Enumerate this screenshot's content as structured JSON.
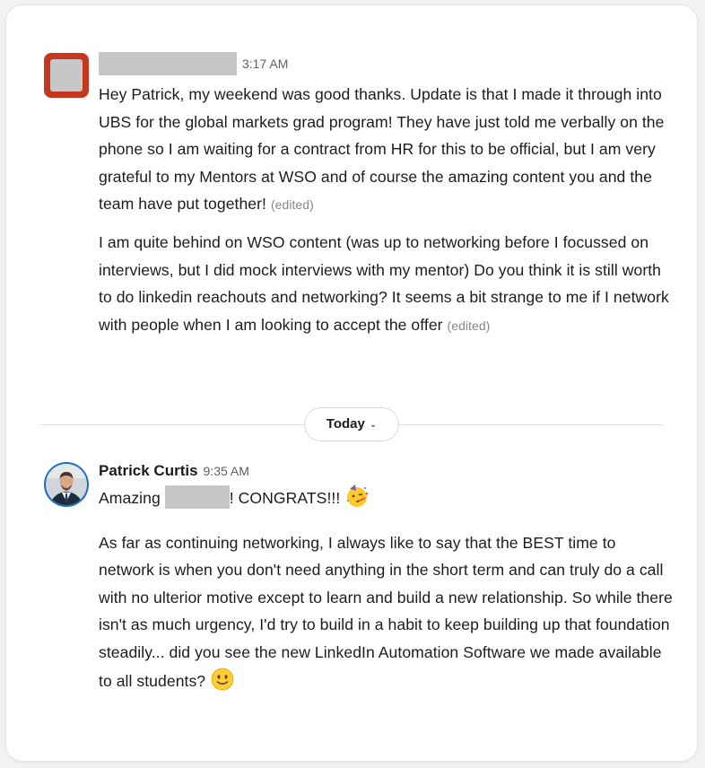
{
  "messages": [
    {
      "sender": "",
      "time": "3:17 AM",
      "paragraphs": [
        {
          "text": "Hey Patrick, my weekend was good thanks. Update is that I made it through into UBS for the global markets grad program! They have just told me verbally on the phone so I am waiting for a contract from HR for this to be official, but I am very grateful to my Mentors at WSO and of course the amazing content you and the team have put together!",
          "edited": "(edited)"
        },
        {
          "text": "I am quite behind on WSO content (was up to networking before I focussed on interviews, but I did mock interviews with my mentor) Do you think it is still worth to do linkedin reachouts and networking? It seems a bit strange to me if I network with people when I am looking to accept the offer",
          "edited": "(edited)"
        }
      ]
    },
    {
      "sender": "Patrick Curtis",
      "time": "9:35 AM",
      "line1_prefix": "Amazing",
      "line1_suffix": "!  CONGRATS!!!",
      "line1_emoji": "partying-face-icon",
      "paragraph": "As far as continuing networking, I always like to say that the BEST time to network is when you don't need anything in the short term and can truly do a call with no ulterior motive except to learn and build a new relationship.  So while there isn't as much urgency, I'd try to build in a habit to keep building up that foundation steadily...  did you see the new LinkedIn Automation Software we made available to all students?",
      "end_emoji": "slightly-smiling-face-icon"
    }
  ],
  "day_divider": {
    "label": "Today"
  },
  "colors": {
    "avatar_accent": "#c4391d",
    "text": "#1d1c1d",
    "muted": "#616061"
  }
}
